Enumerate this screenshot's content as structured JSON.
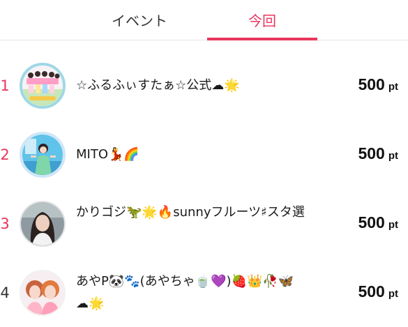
{
  "tabs": [
    {
      "label": "イベント",
      "active": false
    },
    {
      "label": "今回",
      "active": true
    }
  ],
  "colors": {
    "accent": "#e8365d",
    "rank_top": "#e8365d",
    "rank_other": "#333333"
  },
  "ranking": [
    {
      "rank": "1",
      "name": "☆ふるふぃすたぁ☆公式☁🌟",
      "points": "500",
      "unit": "pt",
      "avatar": "group-photo"
    },
    {
      "rank": "2",
      "name": "MITO💃🌈",
      "points": "500",
      "unit": "pt",
      "avatar": "person-photo"
    },
    {
      "rank": "3",
      "name": "かりゴジ🦖🌟🔥sunnyフルーツ♯スタ選",
      "points": "500",
      "unit": "pt",
      "avatar": "person-photo"
    },
    {
      "rank": "4",
      "name": "あやP🐼🐾(あやちゃ🍵💜)🍓👑🥀🦋☁🌟",
      "points": "500",
      "unit": "pt",
      "avatar": "duo-photo"
    }
  ]
}
